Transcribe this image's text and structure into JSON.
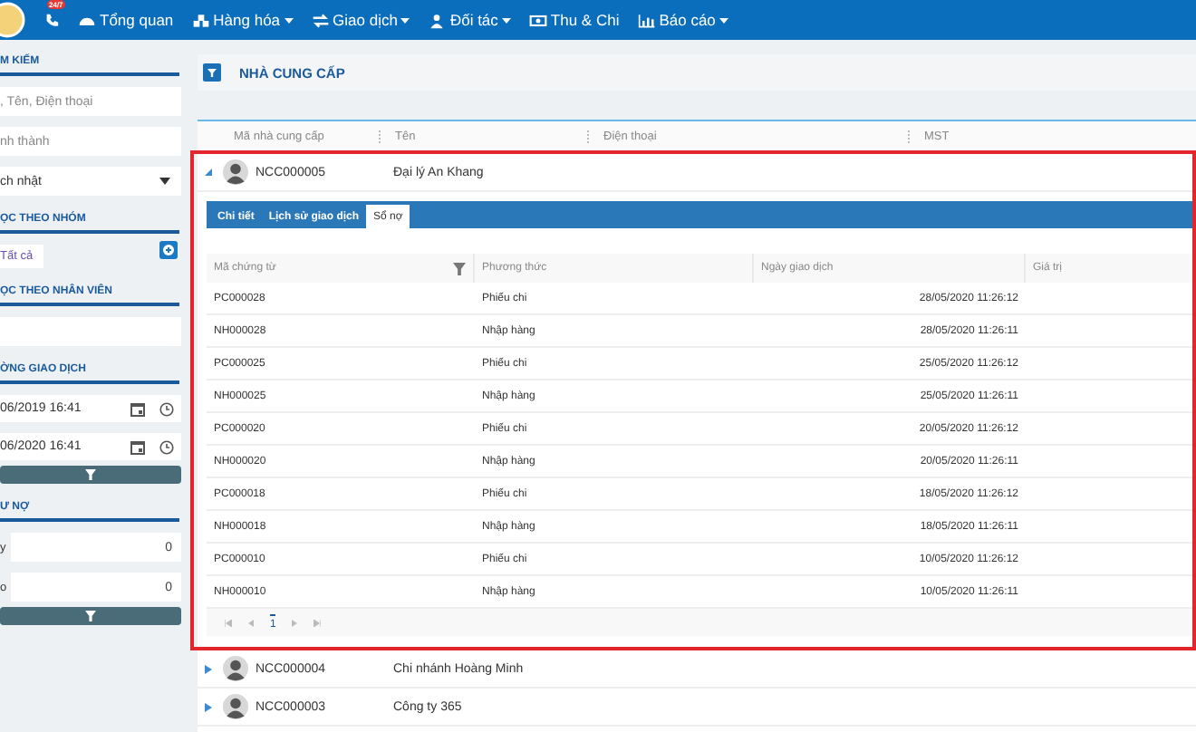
{
  "topbar": {
    "phone_badge": "24/7",
    "nav": [
      {
        "label": "Tổng quan",
        "dropdown": false
      },
      {
        "label": "Hàng hóa",
        "dropdown": true
      },
      {
        "label": "Giao dịch",
        "dropdown": true
      },
      {
        "label": "Đối tác",
        "dropdown": true
      },
      {
        "label": "Thu & Chi",
        "dropdown": false
      },
      {
        "label": "Báo cáo",
        "dropdown": true
      }
    ]
  },
  "sidebar": {
    "sections": [
      {
        "title": "M KIẾM",
        "fields": [
          {
            "kind": "text",
            "placeholder": ", Tên, Điện thoại"
          },
          {
            "kind": "text",
            "placeholder": "nh thành"
          },
          {
            "kind": "select",
            "value": "ch nhật"
          }
        ]
      },
      {
        "title": "ỌC THEO NHÓM",
        "fields": [
          {
            "kind": "tag",
            "value": "Tất cả"
          }
        ]
      },
      {
        "title": "ỌC THEO NHÂN VIÊN",
        "fields": [
          {
            "kind": "text"
          }
        ]
      },
      {
        "title": "ỜNG GIAO DỊCH",
        "fields": [
          {
            "kind": "date",
            "value": "06/2019 16:41"
          },
          {
            "kind": "date",
            "value": "06/2020 16:41"
          },
          {
            "kind": "filter"
          }
        ]
      },
      {
        "title": "Ư NỢ",
        "fields": [
          {
            "kind": "range",
            "label": "y",
            "value": "0"
          },
          {
            "kind": "range",
            "label": "o",
            "value": "0"
          },
          {
            "kind": "filter"
          }
        ]
      }
    ]
  },
  "page": {
    "title": "NHÀ CUNG CẤP",
    "columns": [
      "Mã nhà cung cấp",
      "Tên",
      "Điện thoại",
      "MST"
    ],
    "suppliers": [
      {
        "code": "NCC000005",
        "name": "Đại lý An Khang",
        "expanded": true,
        "detail": {
          "tabs": [
            {
              "label": "Chi tiết",
              "selected": false
            },
            {
              "label": "Lịch sử giao dịch",
              "selected": false
            },
            {
              "label": "Sổ nợ",
              "selected": true
            }
          ],
          "columns": [
            "Mã chứng từ",
            "Phương thức",
            "Ngày giao dịch",
            "Giá trị"
          ],
          "rows": [
            {
              "code": "PC000028",
              "method": "Phiếu chi",
              "date": "28/05/2020 11:26:12"
            },
            {
              "code": "NH000028",
              "method": "Nhập hàng",
              "date": "28/05/2020 11:26:11"
            },
            {
              "code": "PC000025",
              "method": "Phiếu chi",
              "date": "25/05/2020 11:26:12"
            },
            {
              "code": "NH000025",
              "method": "Nhập hàng",
              "date": "25/05/2020 11:26:11"
            },
            {
              "code": "PC000020",
              "method": "Phiếu chi",
              "date": "20/05/2020 11:26:12"
            },
            {
              "code": "NH000020",
              "method": "Nhập hàng",
              "date": "20/05/2020 11:26:11"
            },
            {
              "code": "PC000018",
              "method": "Phiếu chi",
              "date": "18/05/2020 11:26:12"
            },
            {
              "code": "NH000018",
              "method": "Nhập hàng",
              "date": "18/05/2020 11:26:11"
            },
            {
              "code": "PC000010",
              "method": "Phiếu chi",
              "date": "10/05/2020 11:26:12"
            },
            {
              "code": "NH000010",
              "method": "Nhập hàng",
              "date": "10/05/2020 11:26:11"
            }
          ],
          "pager": {
            "current": "1"
          }
        }
      },
      {
        "code": "NCC000004",
        "name": "Chi nhánh Hoàng Minh",
        "expanded": false
      },
      {
        "code": "NCC000003",
        "name": "Công ty 365",
        "expanded": false
      }
    ]
  }
}
